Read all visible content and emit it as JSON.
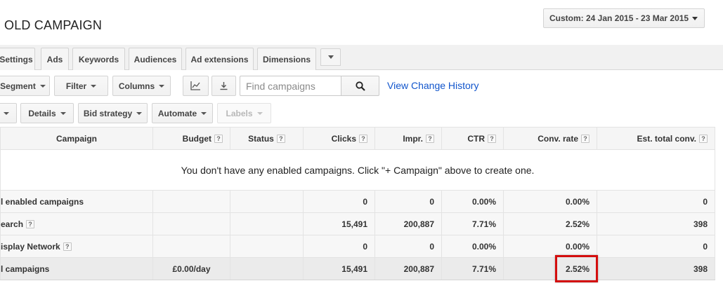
{
  "header": {
    "title": "OLD CAMPAIGN",
    "date_range": "Custom: 24 Jan 2015 - 23 Mar 2015"
  },
  "tabs": [
    {
      "label": "Settings"
    },
    {
      "label": "Ads"
    },
    {
      "label": "Keywords"
    },
    {
      "label": "Audiences"
    },
    {
      "label": "Ad extensions"
    },
    {
      "label": "Dimensions"
    }
  ],
  "toolbar": {
    "segment": "Segment",
    "filter": "Filter",
    "columns": "Columns",
    "search_placeholder": "Find campaigns",
    "change_history": "View Change History",
    "details": "Details",
    "bid_strategy": "Bid strategy",
    "automate": "Automate",
    "labels": "Labels"
  },
  "table": {
    "columns": {
      "campaign": "Campaign",
      "budget": "Budget",
      "status": "Status",
      "clicks": "Clicks",
      "impr": "Impr.",
      "ctr": "CTR",
      "conv_rate": "Conv. rate",
      "est_total_conv": "Est. total conv."
    },
    "help_glyph": "?",
    "empty_message": "You don't have any enabled campaigns. Click \"+ Campaign\" above to create one.",
    "rows": [
      {
        "name": "l enabled campaigns",
        "budget": "",
        "status": "",
        "clicks": "0",
        "impr": "0",
        "ctr": "0.00%",
        "conv_rate": "0.00%",
        "est_total_conv": "0"
      },
      {
        "name": "earch",
        "budget": "",
        "status": "",
        "clicks": "15,491",
        "impr": "200,887",
        "ctr": "7.71%",
        "conv_rate": "2.52%",
        "est_total_conv": "398"
      },
      {
        "name": "isplay Network",
        "budget": "",
        "status": "",
        "clicks": "0",
        "impr": "0",
        "ctr": "0.00%",
        "conv_rate": "0.00%",
        "est_total_conv": "0"
      },
      {
        "name": "l campaigns",
        "budget": "£0.00/day",
        "status": "",
        "clicks": "15,491",
        "impr": "200,887",
        "ctr": "7.71%",
        "conv_rate": "2.52%",
        "est_total_conv": "398"
      }
    ]
  },
  "colors": {
    "link": "#1155cc",
    "highlight": "#d40e0e"
  }
}
